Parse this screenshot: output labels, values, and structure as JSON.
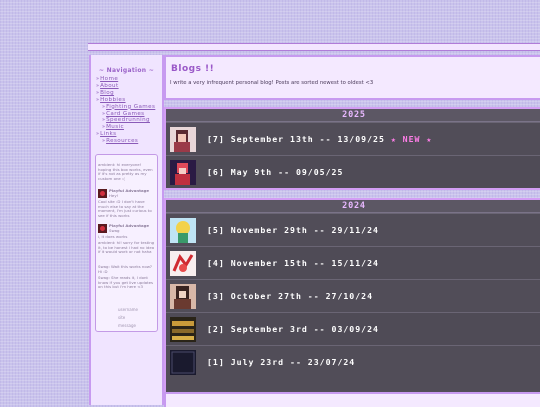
{
  "nav": {
    "title": "~ Navigation ~",
    "items": [
      {
        "label": "Home"
      },
      {
        "label": "About"
      },
      {
        "label": "Blog"
      },
      {
        "label": "Hobbies"
      },
      {
        "label": "Fighting Games"
      },
      {
        "label": "Card Games"
      },
      {
        "label": "Speedrunning"
      },
      {
        "label": "Music"
      },
      {
        "label": "Links"
      },
      {
        "label": "Resources"
      }
    ]
  },
  "chat": {
    "m1": "ambient: hi everyone! hoping this box works, even if it's not as pretty as my custom one :(",
    "m2_name": "Playful Advantage",
    "m2_text": "Hey!",
    "m3": "Cool site :D I don't have much else to say at the moment, I'm just curious to see if this works",
    "m4_name": "Playful Advantage",
    "m4_text": "Swag",
    "m5": "i, it does works",
    "m6": "ambient: hi! sorry for testing it, to be honest i had no idea if it would work or not haha",
    "m7": "Swag: Wait this works now? Hi :D",
    "m8": "Swag: She reads it, I dont know if you get live updates on this but i'm here <3",
    "name_ph": "username",
    "site_ph": "site",
    "msg_ph": "message"
  },
  "header": {
    "title": "Blogs !!",
    "desc": "I write a very infrequent personal blog! Posts are sorted newest to oldest <3"
  },
  "sections": [
    {
      "year": "2025",
      "posts": [
        {
          "title": "[7] September 13th -- 13/09/25",
          "badge": "★ NEW ★",
          "thumb": "anime-girl-icon"
        },
        {
          "title": "[6] May 9th -- 09/05/25",
          "badge": "",
          "thumb": "red-character-icon"
        }
      ]
    },
    {
      "year": "2024",
      "posts": [
        {
          "title": "[5] November 29th -- 29/11/24",
          "thumb": "yellow-character-icon"
        },
        {
          "title": "[4] November 15th -- 15/11/24",
          "thumb": "red-sketch-icon"
        },
        {
          "title": "[3] October 27th -- 27/10/24",
          "thumb": "dark-character-icon"
        },
        {
          "title": "[2] September 3rd -- 03/09/24",
          "thumb": "store-shelf-icon"
        },
        {
          "title": "[1] July 23rd -- 23/07/24",
          "thumb": "night-icon"
        }
      ]
    }
  ],
  "colors": {
    "accent": "#9a58c8",
    "new_badge": "#ff7ee8",
    "panel": "#514d58"
  }
}
